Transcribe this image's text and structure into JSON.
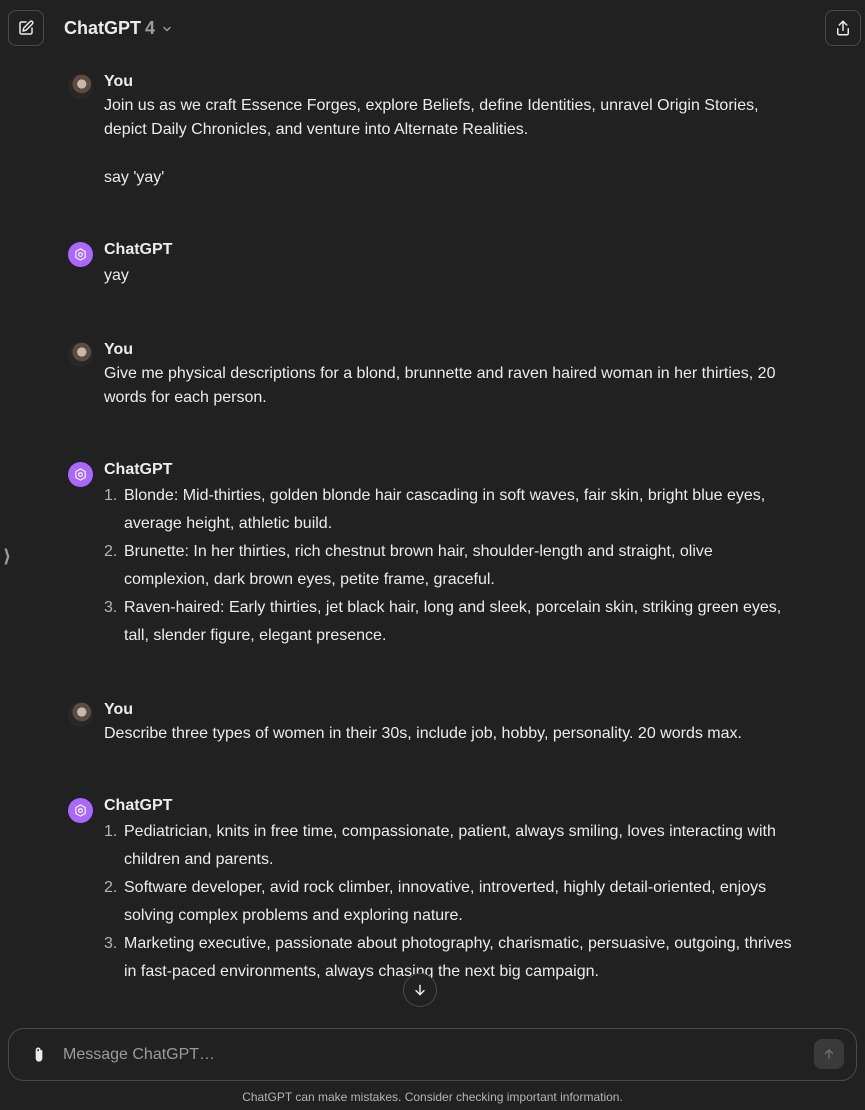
{
  "header": {
    "model_name": "ChatGPT",
    "model_version": "4"
  },
  "messages": [
    {
      "author": "You",
      "role": "user",
      "paragraphs": [
        "Join us as we craft Essence Forges, explore Beliefs, define Identities, unravel Origin Stories, depict Daily Chronicles, and venture into Alternate Realities.",
        "say 'yay'"
      ]
    },
    {
      "author": "ChatGPT",
      "role": "assistant",
      "paragraphs": [
        "yay"
      ]
    },
    {
      "author": "You",
      "role": "user",
      "paragraphs": [
        "Give me physical descriptions for a blond, brunnette and raven haired woman in her thirties, 20 words for each person."
      ]
    },
    {
      "author": "ChatGPT",
      "role": "assistant",
      "list": [
        {
          "num": "1.",
          "text": "Blonde: Mid-thirties, golden blonde hair cascading in soft waves, fair skin, bright blue eyes, average height, athletic build."
        },
        {
          "num": "2.",
          "text": "Brunette: In her thirties, rich chestnut brown hair, shoulder-length and straight, olive complexion, dark brown eyes, petite frame, graceful."
        },
        {
          "num": "3.",
          "text": "Raven-haired: Early thirties, jet black hair, long and sleek, porcelain skin, striking green eyes, tall, slender figure, elegant presence."
        }
      ]
    },
    {
      "author": "You",
      "role": "user",
      "paragraphs": [
        "Describe three types of women in their 30s, include job, hobby, personality. 20 words max."
      ]
    },
    {
      "author": "ChatGPT",
      "role": "assistant",
      "list": [
        {
          "num": "1.",
          "text": "Pediatrician, knits in free time, compassionate, patient, always smiling, loves interacting with children and parents."
        },
        {
          "num": "2.",
          "text": "Software developer, avid rock climber, innovative, introverted, highly detail-oriented, enjoys solving complex problems and exploring nature."
        },
        {
          "num": "3.",
          "text": "Marketing executive, passionate about photography, charismatic, persuasive, outgoing, thrives in fast-paced environments, always chasing the next big campaign."
        }
      ]
    }
  ],
  "composer": {
    "placeholder": "Message ChatGPT…"
  },
  "footer": {
    "disclaimer": "ChatGPT can make mistakes. Consider checking important information."
  },
  "colors": {
    "background": "#212121",
    "text": "#ececec",
    "muted": "#9b9b9b",
    "assistant_avatar": "#ab68ff"
  },
  "icons": {
    "new_chat": "new-chat-icon",
    "model_menu": "chevron-down-icon",
    "share": "share-icon",
    "sidebar": "sidebar-toggle-icon",
    "scroll": "arrow-down-icon",
    "attach": "paperclip-icon",
    "send": "arrow-up-icon"
  }
}
